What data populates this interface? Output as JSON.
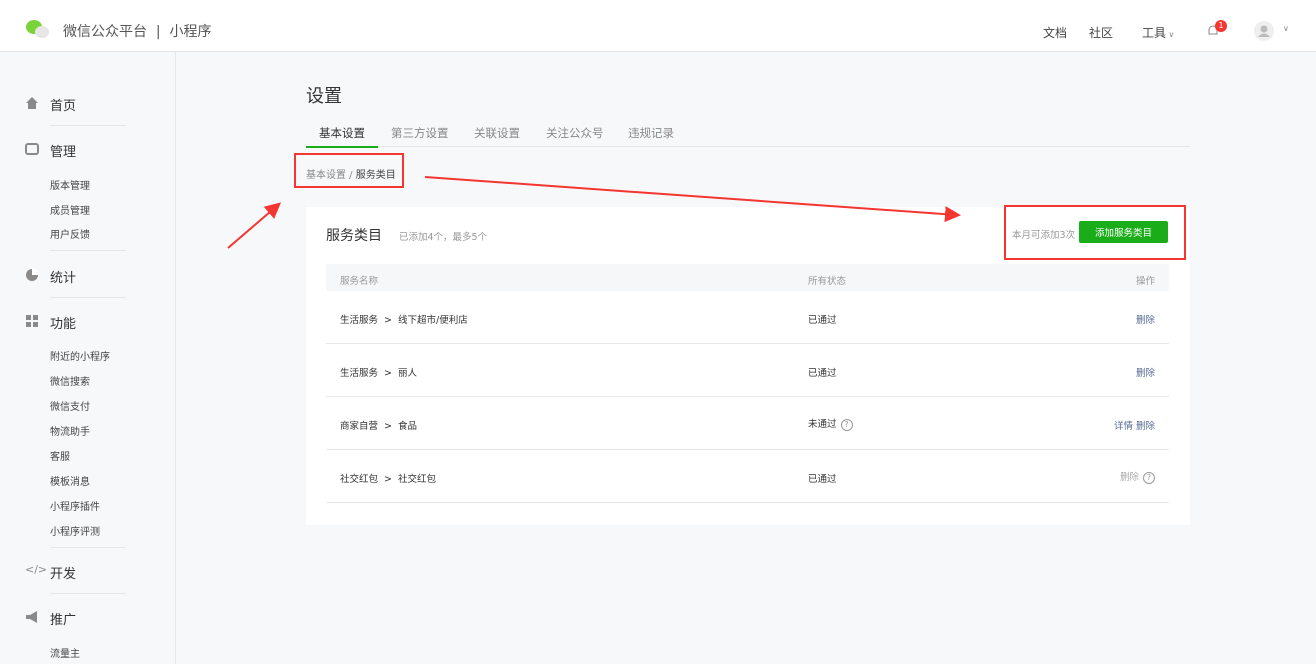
{
  "header": {
    "brand": "微信公众平台",
    "separator": "|",
    "product": "小程序",
    "nav": [
      "文档",
      "社区",
      "工具"
    ],
    "notification_count": "1"
  },
  "sidebar": {
    "home": "首页",
    "manage": "管理",
    "manage_items": [
      "版本管理",
      "成员管理",
      "用户反馈"
    ],
    "stats": "统计",
    "features": "功能",
    "feature_items": [
      "附近的小程序",
      "微信搜索",
      "微信支付",
      "物流助手",
      "客服",
      "模板消息",
      "小程序插件",
      "小程序评测"
    ],
    "dev": "开发",
    "promo": "推广",
    "promo_items": [
      "流量主"
    ]
  },
  "page": {
    "title": "设置",
    "tabs": [
      "基本设置",
      "第三方设置",
      "关联设置",
      "关注公众号",
      "违规记录"
    ],
    "breadcrumb": {
      "parent": "基本设置",
      "sep": " / ",
      "current": "服务类目"
    }
  },
  "card": {
    "title": "服务类目",
    "subtitle": "已添加4个，最多5个",
    "quota": "本月可添加3次",
    "add_button": "添加服务类目",
    "columns": [
      "服务名称",
      "所有状态",
      "操作"
    ],
    "rows": [
      {
        "category": "生活服务  >  线下超市/便利店",
        "status": "已通过",
        "actions": [
          "删除"
        ]
      },
      {
        "category": "生活服务  >  丽人",
        "status": "已通过",
        "actions": [
          "删除"
        ]
      },
      {
        "category": "商家自营  >  食品",
        "status": "未通过",
        "actions": [
          "详情",
          "删除"
        ]
      },
      {
        "category": "社交红包  >  社交红包",
        "status": "已通过",
        "actions": [
          "删除"
        ]
      }
    ]
  },
  "colors": {
    "accent": "#1aad19",
    "link": "#576b95",
    "annotation": "#f43530"
  }
}
